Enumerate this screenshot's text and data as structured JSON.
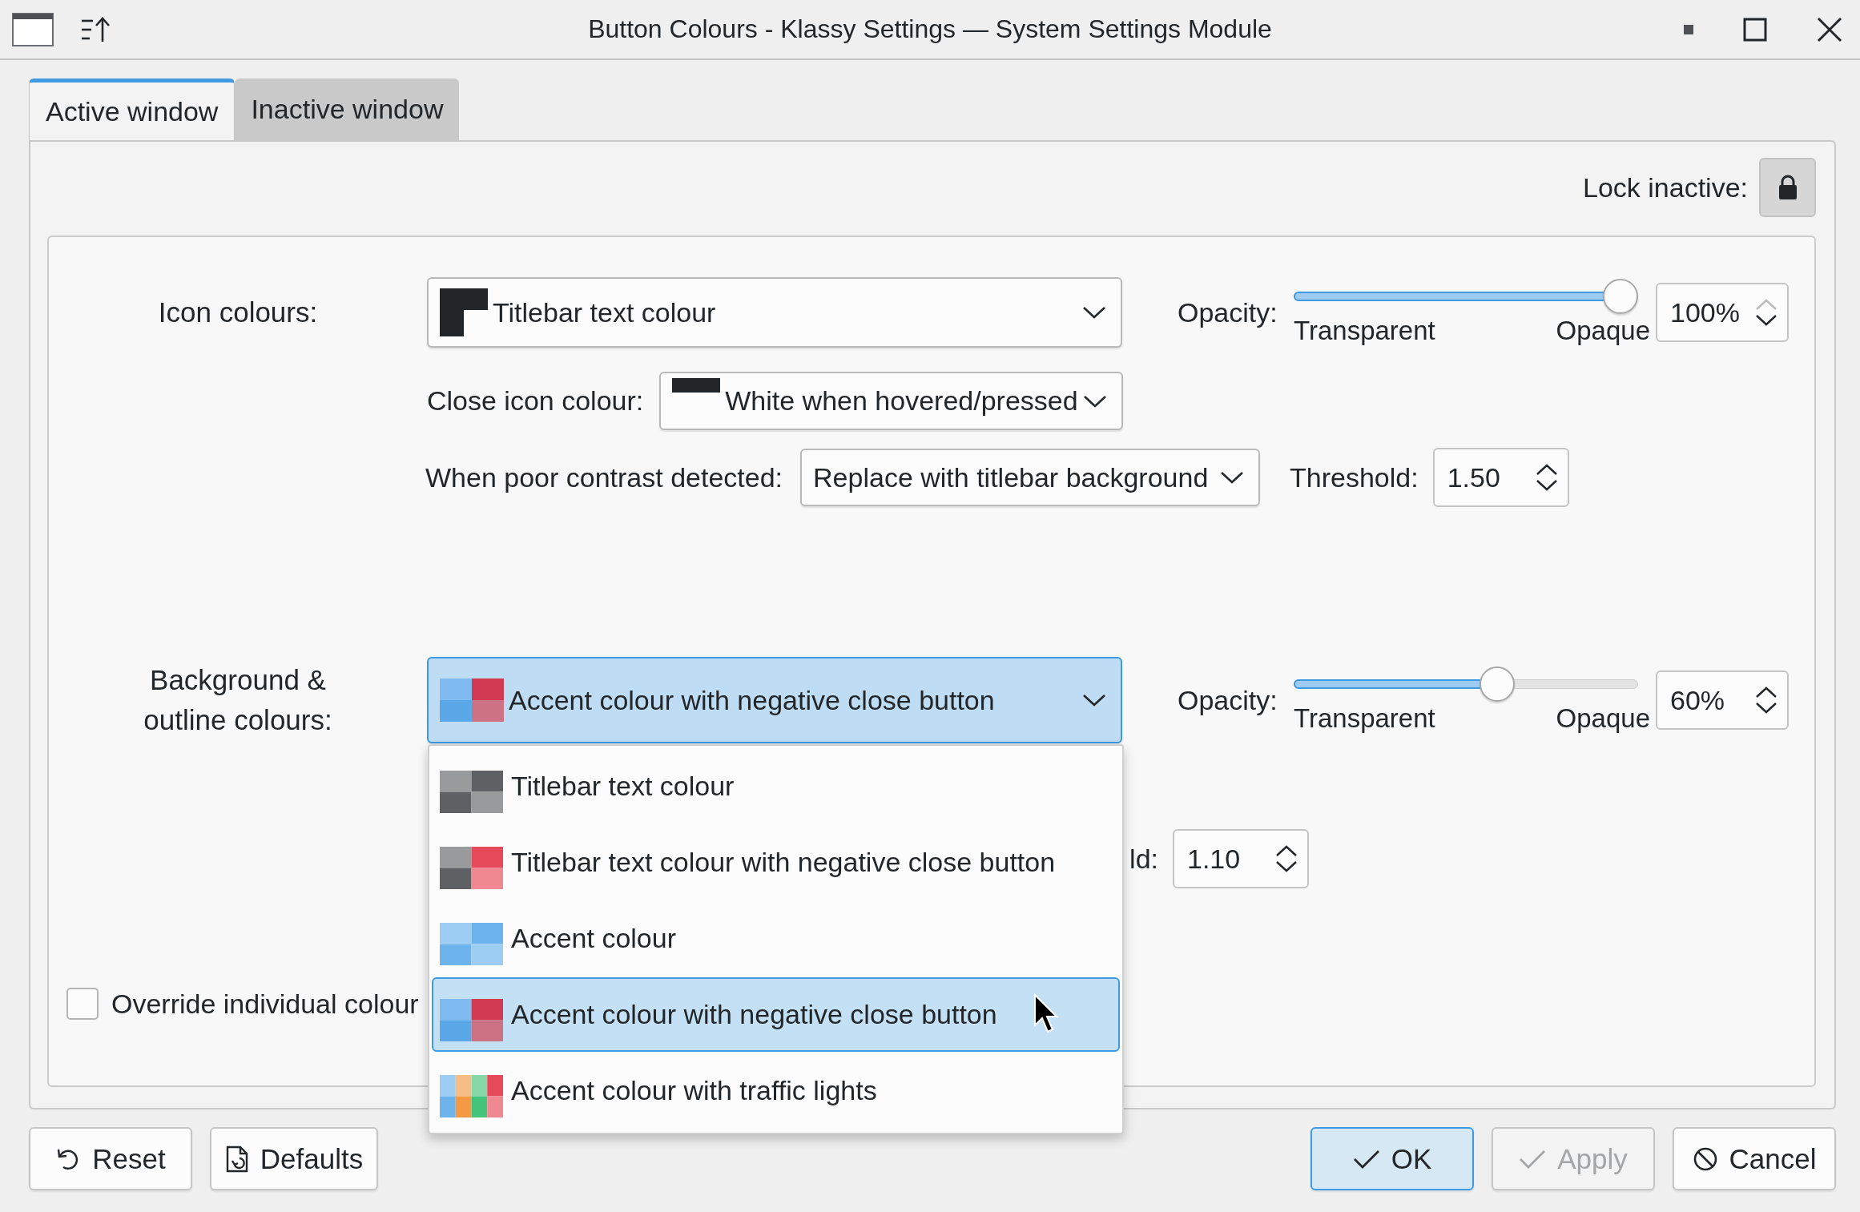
{
  "window": {
    "title": "Button Colours - Klassy Settings — System Settings Module"
  },
  "tabs": [
    {
      "label": "Active window",
      "selected": true
    },
    {
      "label": "Inactive window",
      "selected": false
    }
  ],
  "lock": {
    "label": "Lock inactive:"
  },
  "icon_section": {
    "label": "Icon colours:",
    "combo": {
      "kind": "corner",
      "value": "Titlebar text colour",
      "open": false
    },
    "opacity": {
      "label": "Opacity:",
      "level": 1.0,
      "min_label": "Transparent",
      "max_label": "Opaque",
      "spin": {
        "value": "100%",
        "up_enabled": false
      }
    },
    "close_icon": {
      "label": "Close icon colour:",
      "combo": {
        "kind": "bar",
        "value": "White when hovered/pressed",
        "open": false
      }
    },
    "poor_contrast": {
      "label": "When poor contrast detected:",
      "combo": {
        "value": "Replace with titlebar background",
        "open": false
      },
      "threshold_label": "Threshold:",
      "threshold": {
        "value": "1.50",
        "up_enabled": true
      }
    }
  },
  "background_section": {
    "label": "Background & outline colours:",
    "combo": {
      "kind": "accentred",
      "value": "Accent colour with negative close button",
      "open": true,
      "options": [
        {
          "label": "Titlebar text colour",
          "kind": "grey",
          "selected": false
        },
        {
          "label": "Titlebar text colour with negative close button",
          "kind": "greyred",
          "selected": false
        },
        {
          "label": "Accent colour",
          "kind": "accent",
          "selected": false
        },
        {
          "label": "Accent colour with negative close button",
          "kind": "accentred",
          "selected": true
        },
        {
          "label": "Accent colour with traffic lights",
          "kind": "traffic",
          "selected": false
        }
      ]
    },
    "opacity": {
      "label": "Opacity:",
      "level": 0.6,
      "min_label": "Transparent",
      "max_label": "Opaque",
      "spin": {
        "value": "60%",
        "up_enabled": true
      }
    },
    "threshold_label": "ld:",
    "threshold": {
      "value": "1.10",
      "up_enabled": true
    }
  },
  "override": {
    "label": "Override individual colour",
    "checked": false
  },
  "buttons": [
    {
      "label": "Reset",
      "kind": "undo",
      "default": false,
      "disabled": false
    },
    {
      "label": "Defaults",
      "kind": "document",
      "default": false,
      "disabled": false
    },
    {
      "label": "OK",
      "kind": "check",
      "default": true,
      "disabled": false
    },
    {
      "label": "Apply",
      "kind": "check",
      "default": false,
      "disabled": true
    },
    {
      "label": "Cancel",
      "kind": "cancel",
      "default": false,
      "disabled": false
    }
  ]
}
